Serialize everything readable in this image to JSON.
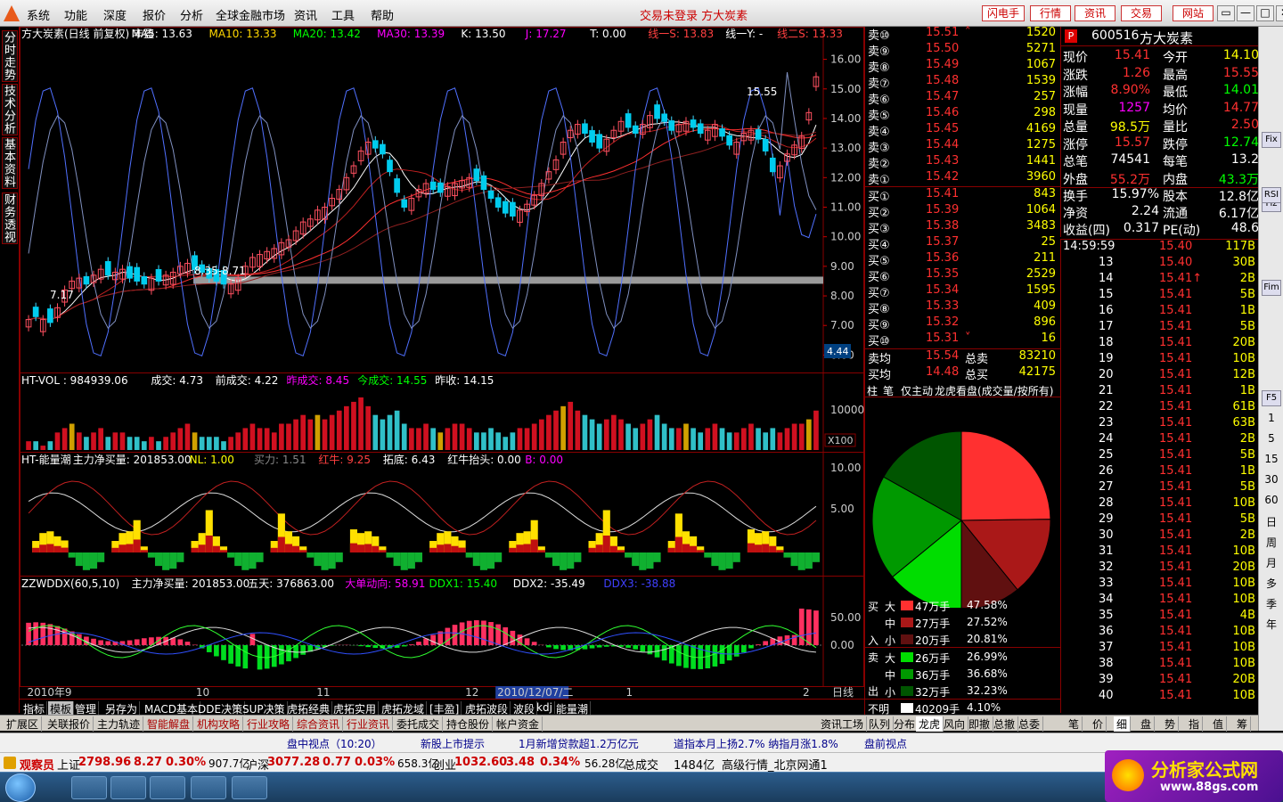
{
  "menubar": {
    "items": [
      "系统",
      "功能",
      "深度",
      "报价",
      "分析",
      "全球金融市场",
      "资讯",
      "工具",
      "帮助"
    ],
    "status_title": "交易未登录  方大炭素",
    "right_buttons": [
      "闪电手",
      "行情",
      "资讯",
      "交易",
      "网站"
    ],
    "win_buttons": [
      "▭",
      "—",
      "□",
      "✕"
    ]
  },
  "left_tabs": [
    "分时走势",
    "技术分析",
    "基本资料",
    "财务透视"
  ],
  "price_chart": {
    "header": [
      {
        "text": "方大炭素(日线 前复权) 丰盈",
        "color": "#ffffff"
      },
      {
        "text": "MA5: 13.63",
        "color": "#ffffff"
      },
      {
        "text": "MA10: 13.33",
        "color": "#ffd700"
      },
      {
        "text": "MA20: 13.42",
        "color": "#00ff00"
      },
      {
        "text": "MA30: 13.39",
        "color": "#ff00ff"
      },
      {
        "text": "K: 13.50",
        "color": "#ffffff"
      },
      {
        "text": "J: 17.27",
        "color": "#ff00ff"
      },
      {
        "text": "T: 0.00",
        "color": "#ffffff"
      },
      {
        "text": "线一S: 13.83",
        "color": "#ff4040"
      },
      {
        "text": "线一Y: -",
        "color": "#ffffff"
      },
      {
        "text": "线二S: 13.33",
        "color": "#ff4040"
      }
    ],
    "y_labels": [
      "16.00",
      "15.00",
      "14.00",
      "13.00",
      "12.00",
      "11.00",
      "10.00",
      "9.00",
      "8.00",
      "7.00",
      "6.00"
    ],
    "y_values": [
      16,
      15,
      14,
      13,
      12,
      11,
      10,
      9,
      8,
      7,
      6
    ],
    "high_label": "15.55",
    "low_label": "7.17",
    "range_label": "8.35-8.71",
    "side_value": "4.44"
  },
  "vol_chart": {
    "header": [
      {
        "text": "HT-VOL : 984939.06",
        "color": "#ffffff"
      },
      {
        "text": "成交: 4.73",
        "color": "#ffffff"
      },
      {
        "text": "前成交: 4.22",
        "color": "#ffffff"
      },
      {
        "text": "昨成交: 8.45",
        "color": "#ff00ff"
      },
      {
        "text": "今成交: 14.55",
        "color": "#00ff00"
      },
      {
        "text": "昨收: 14.15",
        "color": "#ffffff"
      }
    ],
    "y_label": "10000",
    "unit": "X100"
  },
  "energy_chart": {
    "header": [
      {
        "text": "HT-能量潮",
        "color": "#ffffff"
      },
      {
        "text": "主力净买量: 201853.00",
        "color": "#ffffff"
      },
      {
        "text": "NL: 1.00",
        "color": "#ffff00"
      },
      {
        "text": "买力: 1.51",
        "color": "#888888"
      },
      {
        "text": "红牛: 9.25",
        "color": "#ff4040"
      },
      {
        "text": "拓底: 6.43",
        "color": "#ffffff"
      },
      {
        "text": "红牛抬头: 0.00",
        "color": "#ffffff"
      },
      {
        "text": "B: 0.00",
        "color": "#ff00ff"
      }
    ],
    "y_labels": [
      "10.00",
      "5.00"
    ]
  },
  "ddx_chart": {
    "header": [
      {
        "text": "ZZWDDX(60,5,10)",
        "color": "#ffffff"
      },
      {
        "text": "主力净买量: 201853.00",
        "color": "#ffffff"
      },
      {
        "text": "五天: 376863.00",
        "color": "#ffffff"
      },
      {
        "text": "大单动向: 58.91",
        "color": "#ff00ff"
      },
      {
        "text": "DDX1: 15.40",
        "color": "#00ff00"
      },
      {
        "text": "DDX2: -35.49",
        "color": "#ffffff"
      },
      {
        "text": "DDX3: -38.88",
        "color": "#4040ff"
      }
    ],
    "y_labels": [
      "50.00",
      "0.00"
    ]
  },
  "time_axis": {
    "labels": [
      {
        "text": "2010年",
        "pos": 0.005
      },
      {
        "text": "9",
        "pos": 0.052
      },
      {
        "text": "10",
        "pos": 0.215
      },
      {
        "text": "11",
        "pos": 0.365
      },
      {
        "text": "12",
        "pos": 0.55
      },
      {
        "text": "2010/12/07/二",
        "pos": 0.59
      },
      {
        "text": "1",
        "pos": 0.75
      },
      {
        "text": "2",
        "pos": 0.97
      }
    ],
    "period_label": "日线"
  },
  "bottom_tabs1": [
    "指标",
    "模板",
    "管理",
    "另存为",
    "MACD基本",
    "DDE决策",
    "SUP决策",
    "虎拓经典",
    "虎拓实用",
    "虎拓龙域",
    "[丰盈]",
    "虎拓波段",
    "波段",
    "kdj",
    "能量潮"
  ],
  "bottom_tabs2": [
    "扩展区",
    "关联报价",
    "主力轨迹",
    "智能解盘",
    "机构攻略",
    "行业攻略",
    "综合资讯",
    "行业资讯",
    "委托成交",
    "持仓股份",
    "帐户资金"
  ],
  "bottom_tabs2_right": "资讯工场",
  "panel_tabs_right": [
    "队列",
    "分布",
    "龙虎",
    "风向",
    "即撤",
    "总撤",
    "总委"
  ],
  "tick_tabs": [
    "笔",
    "价",
    "细",
    "盘",
    "势",
    "指",
    "值",
    "筹"
  ],
  "orderbook": {
    "asks": [
      {
        "label": "卖⑩",
        "price": "15.51",
        "vol": "1520",
        "mark": "˄"
      },
      {
        "label": "卖⑨",
        "price": "15.50",
        "vol": "5271",
        "mark": ""
      },
      {
        "label": "卖⑧",
        "price": "15.49",
        "vol": "1067",
        "mark": ""
      },
      {
        "label": "卖⑦",
        "price": "15.48",
        "vol": "1539",
        "mark": ""
      },
      {
        "label": "卖⑥",
        "price": "15.47",
        "vol": "257",
        "mark": ""
      },
      {
        "label": "卖⑤",
        "price": "15.46",
        "vol": "298",
        "mark": ""
      },
      {
        "label": "卖④",
        "price": "15.45",
        "vol": "4169",
        "mark": ""
      },
      {
        "label": "卖③",
        "price": "15.44",
        "vol": "1275",
        "mark": ""
      },
      {
        "label": "卖②",
        "price": "15.43",
        "vol": "1441",
        "mark": ""
      },
      {
        "label": "卖①",
        "price": "15.42",
        "vol": "3960",
        "mark": ""
      }
    ],
    "bids": [
      {
        "label": "买①",
        "price": "15.41",
        "vol": "843",
        "mark": ""
      },
      {
        "label": "买②",
        "price": "15.39",
        "vol": "1064",
        "mark": ""
      },
      {
        "label": "买③",
        "price": "15.38",
        "vol": "3483",
        "mark": ""
      },
      {
        "label": "买④",
        "price": "15.37",
        "vol": "25",
        "mark": ""
      },
      {
        "label": "买⑤",
        "price": "15.36",
        "vol": "211",
        "mark": ""
      },
      {
        "label": "买⑥",
        "price": "15.35",
        "vol": "2529",
        "mark": ""
      },
      {
        "label": "买⑦",
        "price": "15.34",
        "vol": "1595",
        "mark": ""
      },
      {
        "label": "买⑧",
        "price": "15.33",
        "vol": "409",
        "mark": ""
      },
      {
        "label": "买⑨",
        "price": "15.32",
        "vol": "896",
        "mark": ""
      },
      {
        "label": "买⑩",
        "price": "15.31",
        "vol": "16",
        "mark": "˅"
      }
    ],
    "sell_avg": {
      "label": "卖均",
      "price": "15.54",
      "tlabel": "总卖",
      "total": "83210"
    },
    "buy_avg": {
      "label": "买均",
      "price": "14.48",
      "tlabel": "总买",
      "total": "42175"
    },
    "tabs": [
      "柱",
      "笔",
      "仅主动",
      "龙虎看盘(成交量/按所有)"
    ]
  },
  "pie": {
    "slices": [
      {
        "name": "买大",
        "pct": 47.58,
        "color": "#ff3030"
      },
      {
        "name": "买中",
        "pct": 27.52,
        "color": "#aa1818"
      },
      {
        "name": "买小",
        "pct": 20.81,
        "color": "#601010"
      },
      {
        "name": "卖大",
        "pct": 26.99,
        "color": "#00dd00"
      },
      {
        "name": "卖中",
        "pct": 36.68,
        "color": "#009900"
      },
      {
        "name": "卖小",
        "pct": 32.23,
        "color": "#005500"
      }
    ],
    "pie_values": [
      23.8,
      13.8,
      10.4,
      13.5,
      18.3,
      16.2
    ],
    "buy_side": [
      "买",
      "入"
    ],
    "sell_side": [
      "卖",
      "出"
    ],
    "legend": [
      {
        "size": "大",
        "hand": "47万手",
        "pct": "47.58%",
        "color": "#ff3030"
      },
      {
        "size": "中",
        "hand": "27万手",
        "pct": "27.52%",
        "color": "#aa1818"
      },
      {
        "size": "小",
        "hand": "20万手",
        "pct": "20.81%",
        "color": "#601010"
      },
      {
        "size": "大",
        "hand": "26万手",
        "pct": "26.99%",
        "color": "#00dd00"
      },
      {
        "size": "中",
        "hand": "36万手",
        "pct": "36.68%",
        "color": "#009900"
      },
      {
        "size": "小",
        "hand": "32万手",
        "pct": "32.23%",
        "color": "#005500"
      }
    ],
    "unknown": {
      "label": "不明",
      "hand": "40209手",
      "pct": "4.10%"
    }
  },
  "quote": {
    "code_badge": "P",
    "code": "600516",
    "name": "方大炭素",
    "rows": [
      {
        "l1": "现价",
        "v1": "15.41",
        "c1": "#ff3030",
        "l2": "今开",
        "v2": "14.10",
        "c2": "#ffff00"
      },
      {
        "l1": "涨跌",
        "v1": "1.26",
        "c1": "#ff3030",
        "l2": "最高",
        "v2": "15.55",
        "c2": "#ff3030"
      },
      {
        "l1": "涨幅",
        "v1": "8.90%",
        "c1": "#ff3030",
        "l2": "最低",
        "v2": "14.01",
        "c2": "#00ff00"
      },
      {
        "l1": "现量",
        "v1": "1257",
        "c1": "#ff00ff",
        "l2": "均价",
        "v2": "14.77",
        "c2": "#ff3030"
      },
      {
        "l1": "总量",
        "v1": "98.5万",
        "c1": "#ffff00",
        "l2": "量比",
        "v2": "2.50",
        "c2": "#ff3030"
      },
      {
        "l1": "涨停",
        "v1": "15.57",
        "c1": "#ff3030",
        "l2": "跌停",
        "v2": "12.74",
        "c2": "#00ff00"
      },
      {
        "l1": "总笔",
        "v1": "74541",
        "c1": "#ffffff",
        "l2": "每笔",
        "v2": "13.2",
        "c2": "#ffffff"
      },
      {
        "l1": "外盘",
        "v1": "55.2万",
        "c1": "#ff3030",
        "l2": "内盘",
        "v2": "43.3万",
        "c2": "#00ff00"
      }
    ],
    "rows2": [
      {
        "l1": "换手",
        "v1": "15.97%",
        "l2": "股本",
        "v2": "12.8亿"
      },
      {
        "l1": "净资",
        "v1": "2.24",
        "l2": "流通",
        "v2": "6.17亿"
      },
      {
        "l1": "收益(四)",
        "v1": "0.317",
        "l2": "PE(动)",
        "v2": "48.6"
      }
    ]
  },
  "ticks": [
    {
      "t": "14:59:59",
      "p": "15.40",
      "v": "117B",
      "c": "#ff3030"
    },
    {
      "t": "13",
      "p": "15.40",
      "v": "30B",
      "c": "#ff3030"
    },
    {
      "t": "14",
      "p": "15.41↑",
      "v": "2B",
      "c": "#ff3030"
    },
    {
      "t": "15",
      "p": "15.41",
      "v": "5B",
      "c": "#ff3030"
    },
    {
      "t": "16",
      "p": "15.41",
      "v": "1B",
      "c": "#ff3030"
    },
    {
      "t": "17",
      "p": "15.41",
      "v": "5B",
      "c": "#ff3030"
    },
    {
      "t": "18",
      "p": "15.41",
      "v": "20B",
      "c": "#ff3030"
    },
    {
      "t": "19",
      "p": "15.41",
      "v": "10B",
      "c": "#ff3030"
    },
    {
      "t": "20",
      "p": "15.41",
      "v": "12B",
      "c": "#ff3030"
    },
    {
      "t": "21",
      "p": "15.41",
      "v": "1B",
      "c": "#ff3030"
    },
    {
      "t": "22",
      "p": "15.41",
      "v": "61B",
      "c": "#ff3030"
    },
    {
      "t": "23",
      "p": "15.41",
      "v": "63B",
      "c": "#ff3030"
    },
    {
      "t": "24",
      "p": "15.41",
      "v": "2B",
      "c": "#ff3030"
    },
    {
      "t": "25",
      "p": "15.41",
      "v": "5B",
      "c": "#ff3030"
    },
    {
      "t": "26",
      "p": "15.41",
      "v": "1B",
      "c": "#ff3030"
    },
    {
      "t": "27",
      "p": "15.41",
      "v": "5B",
      "c": "#ff3030"
    },
    {
      "t": "28",
      "p": "15.41",
      "v": "10B",
      "c": "#ff3030"
    },
    {
      "t": "29",
      "p": "15.41",
      "v": "5B",
      "c": "#ff3030"
    },
    {
      "t": "30",
      "p": "15.41",
      "v": "2B",
      "c": "#ff3030"
    },
    {
      "t": "31",
      "p": "15.41",
      "v": "10B",
      "c": "#ff3030"
    },
    {
      "t": "32",
      "p": "15.41",
      "v": "20B",
      "c": "#ff3030"
    },
    {
      "t": "33",
      "p": "15.41",
      "v": "10B",
      "c": "#ff3030"
    },
    {
      "t": "34",
      "p": "15.41",
      "v": "10B",
      "c": "#ff3030"
    },
    {
      "t": "35",
      "p": "15.41",
      "v": "4B",
      "c": "#ff3030"
    },
    {
      "t": "36",
      "p": "15.41",
      "v": "10B",
      "c": "#ff3030"
    },
    {
      "t": "37",
      "p": "15.41",
      "v": "10B",
      "c": "#ff3030"
    },
    {
      "t": "38",
      "p": "15.41",
      "v": "10B",
      "c": "#ff3030"
    },
    {
      "t": "39",
      "p": "15.41",
      "v": "20B",
      "c": "#ff3030"
    },
    {
      "t": "40",
      "p": "15.41",
      "v": "10B",
      "c": "#ff3030"
    }
  ],
  "right_sidebar": [
    "1",
    "5",
    "15",
    "30",
    "60",
    "日",
    "周",
    "月",
    "多",
    "季",
    "年"
  ],
  "right_sidebar_icons": [
    "Fix",
    "Fiz",
    "Fim",
    "RSI",
    "F5"
  ],
  "newsbar": [
    "盘中视点（10:20）",
    "新股上市提示",
    "1月新增贷款超1.2万亿元",
    "道指本月上扬2.7% 纳指月涨1.8%",
    "盘前视点"
  ],
  "indexbar": {
    "tag": "观察员",
    "items": [
      {
        "name": "上证",
        "val": "2798.96",
        "chg": "8.27",
        "pct": "0.30%",
        "amt": "907.7亿"
      },
      {
        "name": "沪深",
        "val": "3077.28",
        "chg": "0.77",
        "pct": "0.03%",
        "amt": "658.3亿"
      },
      {
        "name": "创业",
        "val": "1032.60",
        "chg": "3.48",
        "pct": "0.34%",
        "amt": "56.28亿"
      }
    ],
    "total_label": "总成交",
    "total_val": "1484亿",
    "source": "高级行情_北京网通1"
  },
  "watermark": {
    "brand": "分析家公式网",
    "url": "www.88gs.com"
  },
  "chart_data": [
    {
      "type": "candlestick",
      "title": "方大炭素(日线 前复权)",
      "ylim": [
        5.5,
        16.5
      ],
      "ma": {
        "MA5": 13.63,
        "MA10": 13.33,
        "MA20": 13.42,
        "MA30": 13.39
      },
      "candles_close": [
        7.2,
        7.3,
        7.2,
        7.1,
        7.6,
        8.2,
        8.5,
        8.6,
        8.4,
        8.7,
        8.9,
        8.7,
        8.8,
        8.9,
        8.6,
        8.5,
        8.4,
        8.6,
        8.5,
        8.7,
        8.8,
        9.0,
        9.1,
        8.9,
        8.8,
        8.6,
        8.5,
        8.4,
        8.4,
        8.6,
        9.0,
        9.3,
        9.4,
        9.5,
        9.6,
        9.8,
        9.9,
        10.2,
        10.5,
        10.6,
        10.9,
        11.0,
        11.3,
        11.6,
        12.0,
        12.4,
        12.9,
        13.2,
        13.0,
        12.8,
        12.2,
        11.5,
        11.0,
        11.3,
        11.6,
        11.8,
        11.6,
        11.5,
        11.7,
        11.8,
        11.9,
        12.0,
        11.9,
        11.6,
        11.3,
        11.0,
        10.8,
        10.7,
        10.9,
        11.1,
        11.4,
        11.8,
        12.2,
        12.6,
        13.2,
        13.6,
        13.8,
        13.5,
        13.2,
        13.0,
        13.3,
        13.6,
        13.9,
        13.7,
        13.5,
        13.8,
        14.1,
        14.0,
        13.9,
        13.6,
        13.8,
        13.9,
        13.7,
        13.5,
        13.6,
        13.8,
        13.4,
        13.1,
        13.2,
        13.5,
        13.6,
        13.3,
        12.9,
        12.2,
        12.4,
        12.8,
        13.1,
        13.4,
        14.2,
        15.41
      ],
      "candles_up": [
        1,
        0,
        1,
        0,
        1,
        1,
        1,
        1,
        0,
        1,
        1,
        0,
        1,
        1,
        0,
        0,
        0,
        1,
        0,
        1,
        1,
        1,
        1,
        0,
        0,
        0,
        0,
        0,
        1,
        1,
        1,
        1,
        1,
        1,
        1,
        1,
        1,
        1,
        1,
        1,
        1,
        1,
        1,
        1,
        1,
        1,
        1,
        1,
        0,
        0,
        0,
        0,
        0,
        1,
        1,
        1,
        0,
        0,
        1,
        1,
        1,
        1,
        0,
        0,
        0,
        0,
        0,
        0,
        1,
        1,
        1,
        1,
        1,
        1,
        1,
        1,
        1,
        0,
        0,
        0,
        1,
        1,
        1,
        0,
        0,
        1,
        1,
        0,
        0,
        0,
        1,
        1,
        0,
        0,
        1,
        1,
        0,
        0,
        1,
        1,
        1,
        0,
        0,
        0,
        1,
        1,
        1,
        1,
        1,
        1
      ]
    },
    {
      "type": "bar",
      "title": "HT-VOL",
      "values": [
        2,
        2,
        1,
        2,
        4,
        5,
        6,
        4,
        3,
        4,
        5,
        3,
        4,
        4,
        3,
        3,
        2,
        3,
        2,
        3,
        4,
        5,
        6,
        4,
        3,
        3,
        3,
        2,
        3,
        4,
        5,
        6,
        5,
        5,
        4,
        6,
        6,
        7,
        8,
        7,
        8,
        7,
        8,
        9,
        10,
        11,
        12,
        10,
        8,
        7,
        8,
        9,
        6,
        5,
        5,
        6,
        5,
        4,
        5,
        6,
        6,
        5,
        4,
        4,
        5,
        4,
        3,
        4,
        5,
        5,
        6,
        7,
        8,
        9,
        10,
        11,
        9,
        8,
        7,
        6,
        7,
        8,
        7,
        6,
        5,
        6,
        7,
        8,
        6,
        5,
        5,
        6,
        5,
        4,
        5,
        6,
        5,
        4,
        4,
        5,
        6,
        5,
        4,
        5,
        4,
        5,
        6,
        6,
        7,
        9
      ],
      "ylim": [
        0,
        16000
      ]
    },
    {
      "type": "area",
      "title": "HT-能量潮",
      "ylim": [
        -3,
        12
      ]
    },
    {
      "type": "bar",
      "title": "ZZWDDX(60,5,10)",
      "ylim": [
        -40,
        85
      ]
    }
  ]
}
